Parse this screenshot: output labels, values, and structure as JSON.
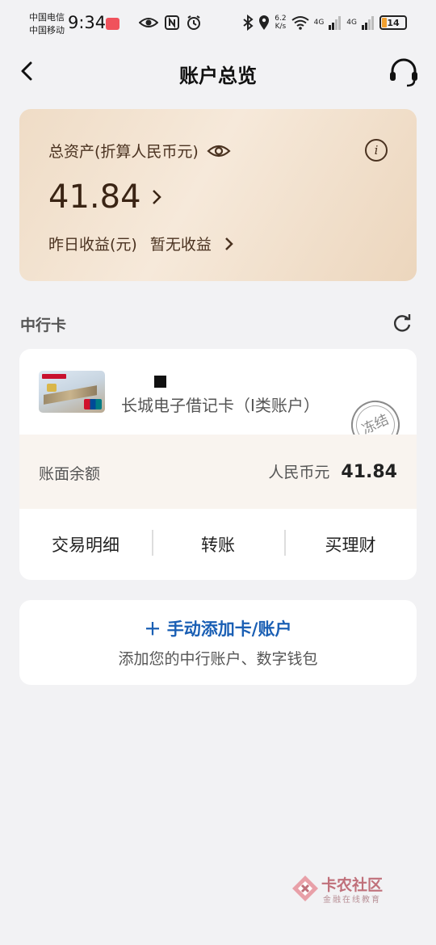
{
  "status_bar": {
    "carrier_1": "中国电信",
    "carrier_2": "中国移动",
    "time": "9:34",
    "net_speed_value": "6.2",
    "net_speed_unit": "K/s",
    "signal_1": "4G",
    "signal_2": "4G",
    "battery": "14"
  },
  "nav": {
    "title": "账户总览"
  },
  "asset_card": {
    "label": "总资产(折算人民币元)",
    "amount": "41.84",
    "info_icon": "i",
    "yesterday_label": "昨日收益(元)",
    "yesterday_value": "暂无收益"
  },
  "section": {
    "title": "中行卡"
  },
  "card": {
    "name": "长城电子借记卡（I类账户）",
    "stamp": "冻结",
    "balance_label": "账面余额",
    "balance_currency": "人民币元",
    "balance_amount": "41.84",
    "actions": [
      "交易明细",
      "转账",
      "买理财"
    ]
  },
  "add_card": {
    "title": "＋ 手动添加卡/账户",
    "subtitle": "添加您的中行账户、数字钱包"
  },
  "watermark": {
    "title": "卡农社区",
    "subtitle": "金融在线教育"
  },
  "colors": {
    "accent_blue": "#1a5fb4",
    "asset_text": "#3a2414",
    "asset_bg": "#f6e9da",
    "page_bg": "#f2f2f4"
  }
}
